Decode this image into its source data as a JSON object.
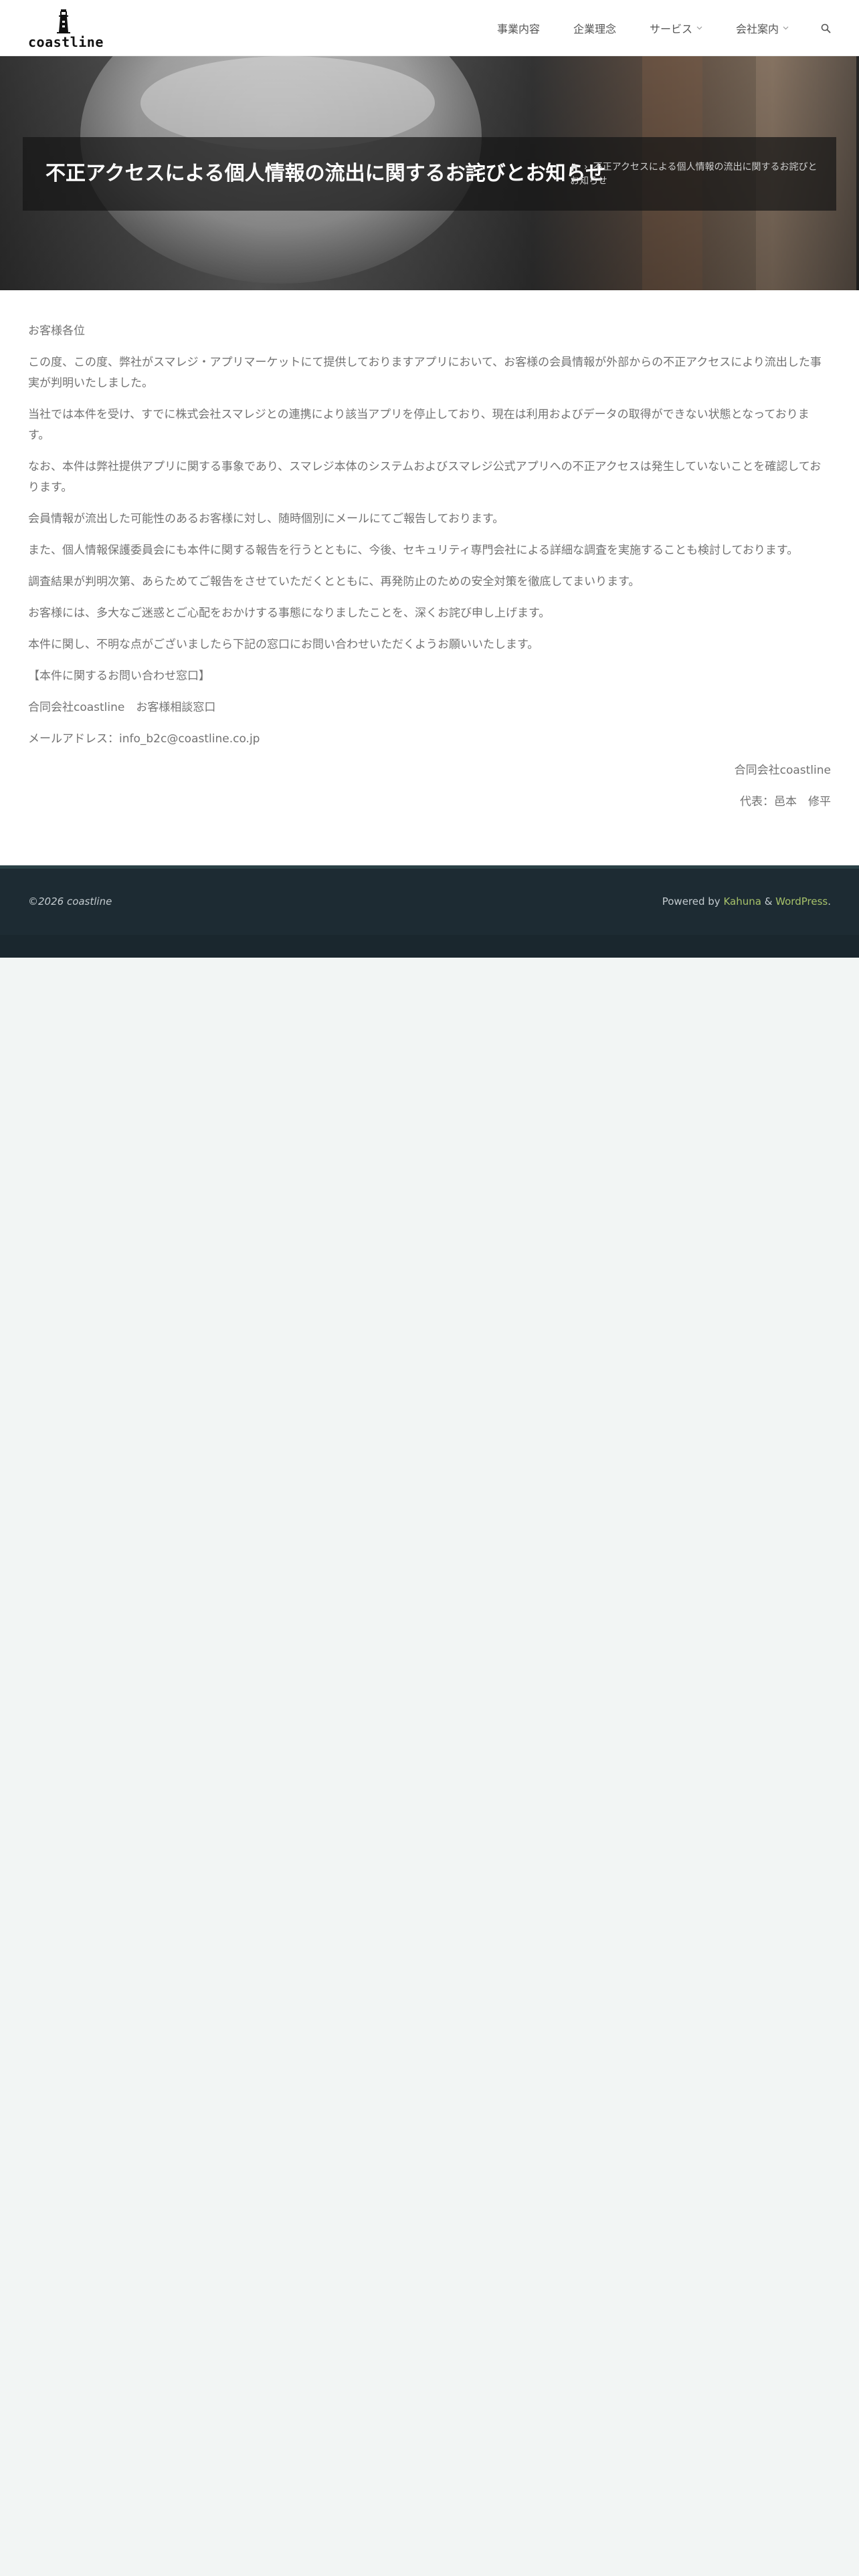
{
  "header": {
    "logo_text": "coastline",
    "nav": [
      {
        "label": "事業内容",
        "has_submenu": false
      },
      {
        "label": "企業理念",
        "has_submenu": false
      },
      {
        "label": "サービス",
        "has_submenu": true
      },
      {
        "label": "会社案内",
        "has_submenu": true
      }
    ],
    "search_icon": "search-icon"
  },
  "hero": {
    "title": "不正アクセスによる個人情報の流出に関するお詫びとお知らせ",
    "breadcrumb": {
      "home_icon": "home-icon",
      "separator": "›",
      "current": "不正アクセスによる個人情報の流出に関するお詫びとお知らせ"
    }
  },
  "article": {
    "paragraphs": [
      "お客様各位",
      "この度、この度、弊社がスマレジ・アプリマーケットにて提供しておりますアプリにおいて、お客様の会員情報が外部からの不正アクセスにより流出した事実が判明いたしました。",
      "当社では本件を受け、すでに株式会社スマレジとの連携により該当アプリを停止しており、現在は利用およびデータの取得ができない状態となっております。",
      "なお、本件は弊社提供アプリに関する事象であり、スマレジ本体のシステムおよびスマレジ公式アプリへの不正アクセスは発生していないことを確認しております。",
      "会員情報が流出した可能性のあるお客様に対し、随時個別にメールにてご報告しております。",
      "また、個人情報保護委員会にも本件に関する報告を行うとともに、今後、セキュリティ専門会社による詳細な調査を実施することも検討しております。",
      "調査結果が判明次第、あらためてご報告をさせていただくとともに、再発防止のための安全対策を徹底してまいります。",
      "お客様には、多大なご迷惑とご心配をおかけする事態になりましたことを、深くお詫び申し上げます。",
      "本件に関し、不明な点がございましたら下記の窓口にお問い合わせいただくようお願いいたします。",
      "【本件に関するお問い合わせ窓口】",
      "合同会社coastline　お客様相談窓口",
      "メールアドレス：info_b2c@coastline.co.jp"
    ],
    "signature": [
      "合同会社coastline",
      "代表：邑本　修平"
    ]
  },
  "footer": {
    "copyright": "©2026 coastline",
    "powered_by": "Powered by ",
    "theme_link": "Kahuna",
    "amp": " & ",
    "wp_link": "WordPress",
    "period": "."
  }
}
